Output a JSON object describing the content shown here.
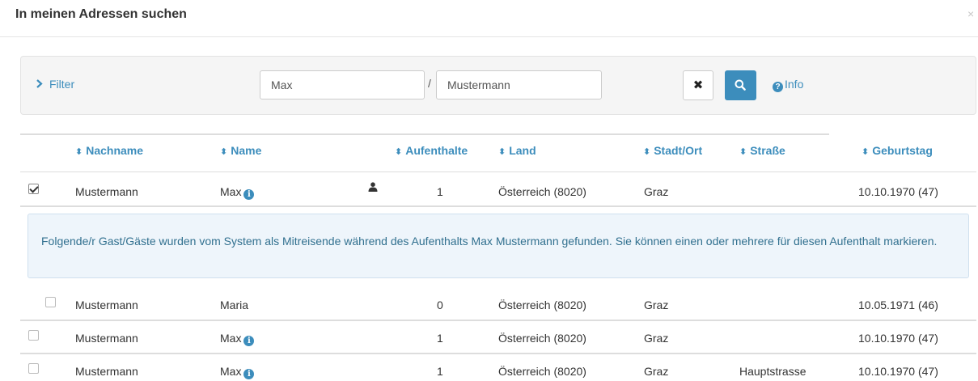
{
  "modal": {
    "title": "In meinen Adressen suchen",
    "close_glyph": "×"
  },
  "filter": {
    "label": "Filter",
    "first_name_value": "Max",
    "separator": "/",
    "last_name_value": "Mustermann",
    "clear_glyph": "✖",
    "info_label": "Info",
    "info_glyph": "?"
  },
  "table": {
    "headers": {
      "nachname": "Nachname",
      "name": "Name",
      "aufenthalte": "Aufenthalte",
      "land": "Land",
      "stadt": "Stadt/Ort",
      "strasse": "Straße",
      "geburtstag": "Geburtstag"
    },
    "rows": [
      {
        "checked": true,
        "nachname": "Mustermann",
        "name": "Max",
        "has_info": true,
        "has_person": true,
        "aufenthalte": "1",
        "land": "Österreich (8020)",
        "stadt": "Graz",
        "strasse": "",
        "geburtstag": "10.10.1970 (47)"
      },
      {
        "checked": false,
        "nachname": "Mustermann",
        "name": "Maria",
        "has_info": false,
        "has_person": false,
        "aufenthalte": "0",
        "land": "Österreich (8020)",
        "stadt": "Graz",
        "strasse": "",
        "geburtstag": "10.05.1971 (46)"
      },
      {
        "checked": false,
        "nachname": "Mustermann",
        "name": "Max",
        "has_info": true,
        "has_person": false,
        "aufenthalte": "1",
        "land": "Österreich (8020)",
        "stadt": "Graz",
        "strasse": "",
        "geburtstag": "10.10.1970 (47)"
      },
      {
        "checked": false,
        "nachname": "Mustermann",
        "name": "Max",
        "has_info": true,
        "has_person": false,
        "aufenthalte": "1",
        "land": "Österreich (8020)",
        "stadt": "Graz",
        "strasse": "Hauptstrasse",
        "geburtstag": "10.10.1970 (47)"
      }
    ],
    "info_glyph": "i"
  },
  "alert": {
    "text": "Folgende/r Gast/Gäste wurden vom System als Mitreisende während des Aufenthalts Max Mustermann gefunden. Sie können einen oder mehrere für diesen Aufenthalt markieren."
  },
  "colors": {
    "link": "#3c8dbc",
    "alert_bg": "#eef5fb",
    "alert_text": "#31708f"
  },
  "icons": [
    "close-icon",
    "chevron-right-icon",
    "times-icon",
    "search-icon",
    "question-circle-icon",
    "sort-icon",
    "checkbox-icon",
    "info-circle-icon",
    "user-icon"
  ]
}
